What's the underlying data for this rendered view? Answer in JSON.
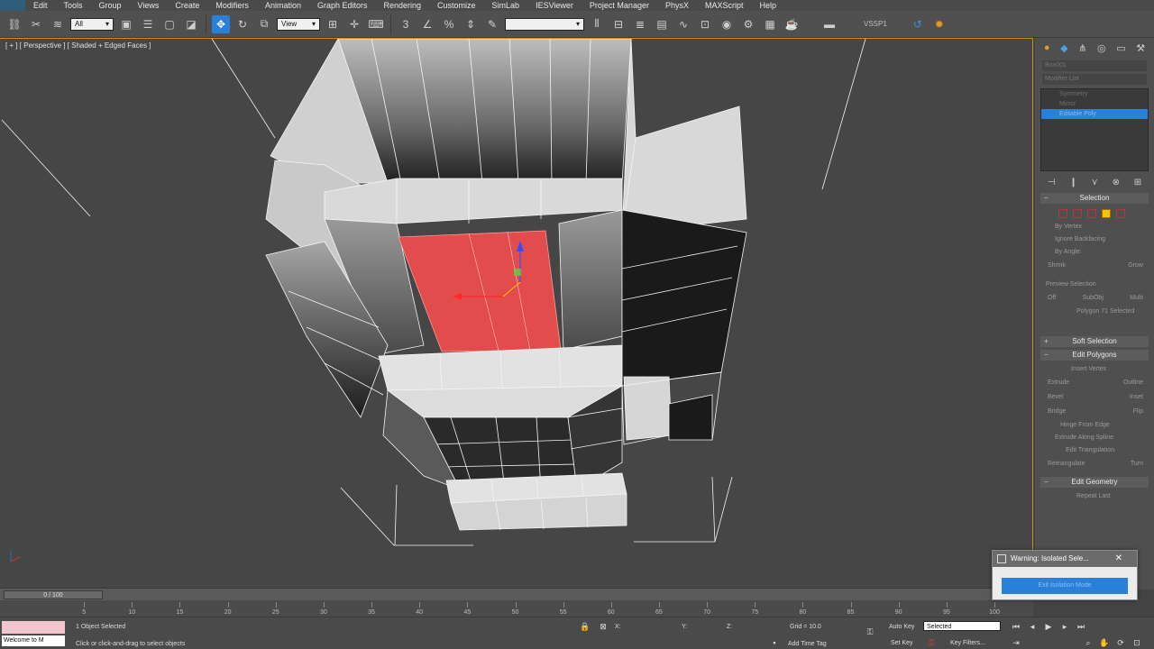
{
  "menu": [
    "Edit",
    "Tools",
    "Group",
    "Views",
    "Create",
    "Modifiers",
    "Animation",
    "Graph Editors",
    "Rendering",
    "Customize",
    "SimLab",
    "IESViewer",
    "Project Manager",
    "PhysX",
    "MAXScript",
    "Help"
  ],
  "toolbar": {
    "selection_filter": "All",
    "ref_coord": "View",
    "named_set": "",
    "vssp_label": "VSSP1"
  },
  "viewport": {
    "label": "[ + ] [ Perspective ] [ Shaded + Edged Faces ]"
  },
  "command_panel": {
    "object_name": "Box001",
    "modifier_list": "Modifier List",
    "stack": [
      "Symmetry",
      "Mirror",
      "Editable Poly"
    ],
    "selection_rollout": "Selection",
    "by_vertex": "By Vertex",
    "ignore_backfacing": "Ignore Backfacing",
    "by_angle": "By Angle:",
    "shrink": "Shrink",
    "grow": "Grow",
    "preview_selection": "Preview Selection",
    "preview_off": "Off",
    "preview_subobj": "SubObj",
    "preview_multi": "Multi",
    "selected_info": "Polygon 71 Selected",
    "soft_selection": "Soft Selection",
    "edit_polygons": "Edit Polygons",
    "insert_vertex": "Insert Vertex",
    "extrude": "Extrude",
    "outline": "Outline",
    "bevel": "Bevel",
    "inset": "Inset",
    "bridge": "Bridge",
    "flip": "Flip",
    "hinge": "Hinge From Edge",
    "extrude_spline": "Extrude Along Spline",
    "edit_triangulation": "Edit Triangulation",
    "retriangulate": "Retriangulate",
    "turn": "Turn",
    "edit_geometry": "Edit Geometry",
    "repeat_last": "Repeat Last"
  },
  "timeline": {
    "frame": "0 / 100",
    "ticks": [
      5,
      10,
      15,
      20,
      25,
      30,
      35,
      40,
      45,
      50,
      55,
      60,
      65,
      70,
      75,
      80,
      85,
      90,
      95,
      100
    ]
  },
  "status": {
    "maxscript": "Welcome to M",
    "objects_selected": "1 Object Selected",
    "prompt": "Click or click-and-drag to select objects",
    "x_label": "X:",
    "y_label": "Y:",
    "z_label": "Z:",
    "grid": "Grid = 10.0",
    "auto_key": "Auto Key",
    "selected_drop": "Selected",
    "set_key": "Set Key",
    "key_filters": "Key Filters...",
    "add_time_tag": "Add Time Tag"
  },
  "popup": {
    "title": "Warning: Isolated Sele...",
    "button": "Exit Isolation Mode"
  }
}
